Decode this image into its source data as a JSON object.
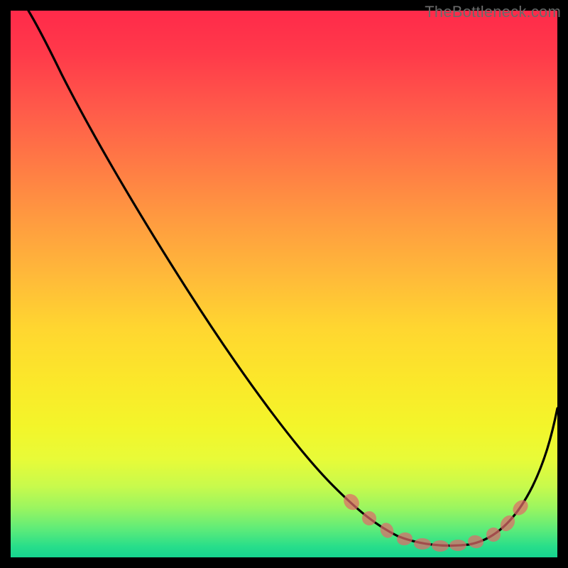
{
  "watermark": "TheBottleneck.com",
  "chart_data": {
    "type": "line",
    "title": "",
    "xlabel": "",
    "ylabel": "",
    "xlim": [
      0,
      100
    ],
    "ylim": [
      0,
      100
    ],
    "series": [
      {
        "name": "bottleneck-curve",
        "x": [
          0,
          3,
          8,
          15,
          25,
          35,
          45,
          55,
          62,
          66,
          70,
          74,
          78,
          82,
          86,
          90,
          94,
          97,
          100
        ],
        "y": [
          100,
          97,
          92,
          85,
          73,
          60,
          47,
          34,
          24,
          18,
          12,
          6,
          3,
          2,
          2,
          3,
          8,
          17,
          30
        ]
      }
    ],
    "highlight_band": {
      "name": "optimal-range",
      "x": [
        66,
        70,
        74,
        78,
        82,
        86,
        90
      ],
      "y": [
        18,
        12,
        6,
        3,
        2,
        2,
        3
      ]
    },
    "background_gradient": {
      "top": "#ff2a4a",
      "mid": "#ffd630",
      "bottom": "#16d48f"
    }
  }
}
